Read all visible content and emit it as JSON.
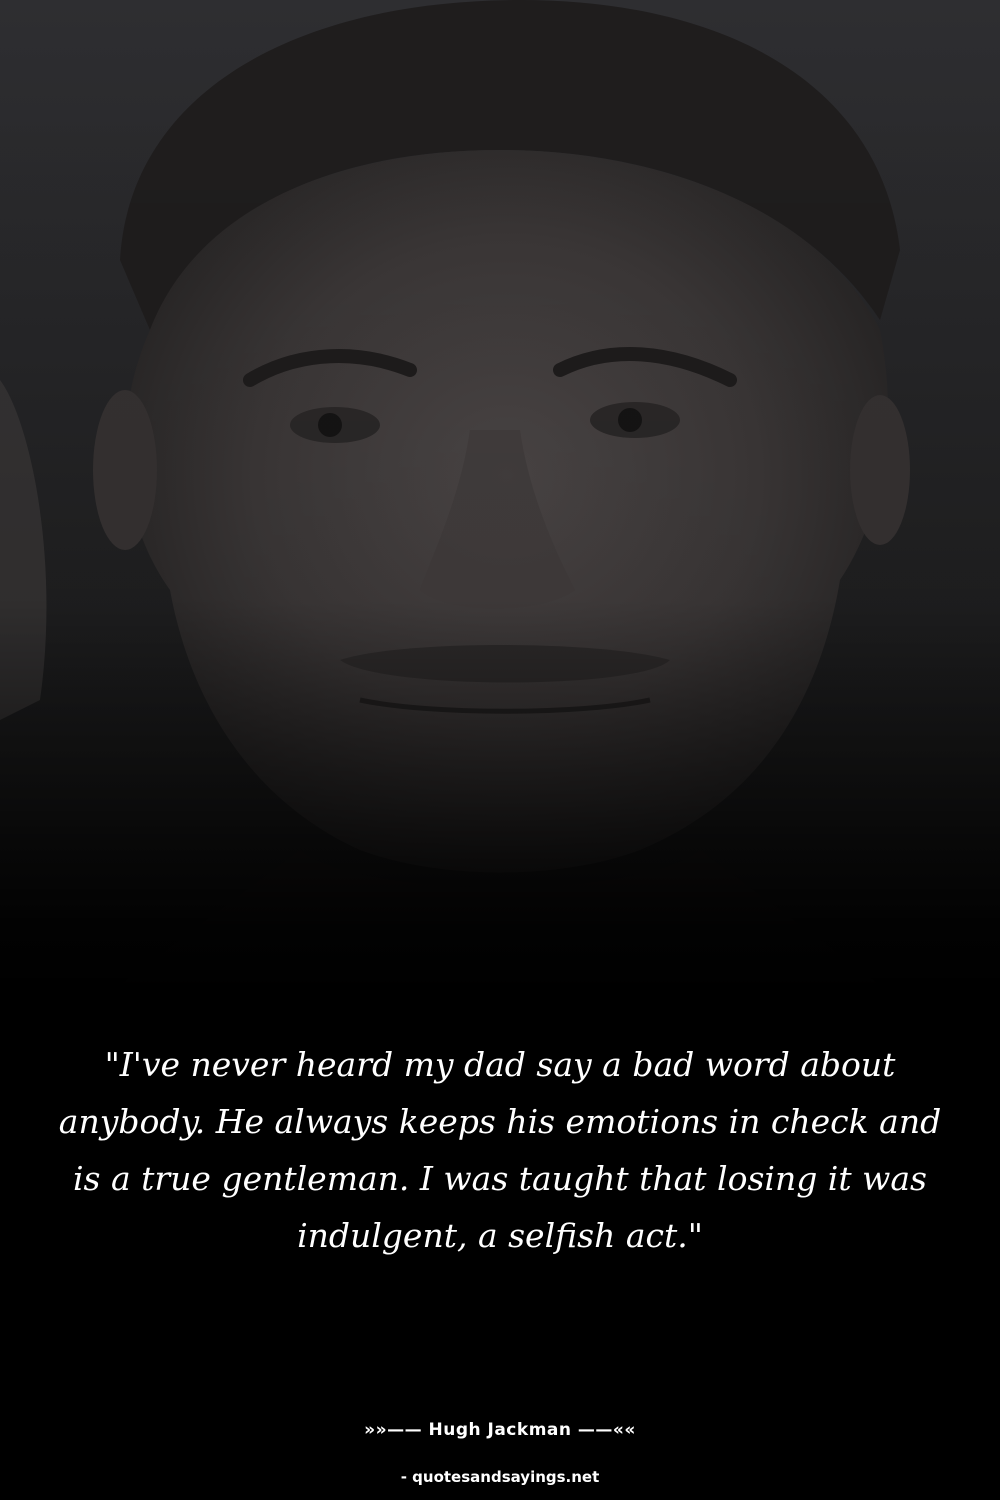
{
  "quote": {
    "text": "\"I've never heard my dad say a bad word about anybody. He always keeps his emotions in check and is a true gentleman. I was taught that losing it was indulgent, a selfish act.\""
  },
  "attribution": {
    "author": "»»—— Hugh Jackman ——««",
    "source": "- quotesandsayings.net"
  }
}
